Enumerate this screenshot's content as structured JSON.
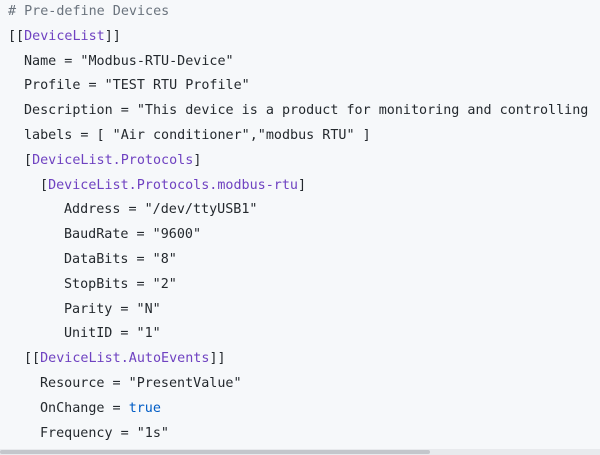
{
  "lines": {
    "l1": "# Pre-define Devices",
    "l2_open": "[[",
    "l2_sec": "DeviceList",
    "l2_close": "]]",
    "l3": "Name = \"Modbus-RTU-Device\"",
    "l4": "Profile = \"TEST RTU Profile\"",
    "l5": "Description = \"This device is a product for monitoring and controlling",
    "l6": "labels = [ \"Air conditioner\",\"modbus RTU\" ]",
    "l7_open": "[",
    "l7_sec": "DeviceList.Protocols",
    "l7_close": "]",
    "l8_open": "[",
    "l8_sec": "DeviceList.Protocols.modbus-rtu",
    "l8_close": "]",
    "l9": "Address = \"/dev/ttyUSB1\"",
    "l10": "BaudRate = \"9600\"",
    "l11": "DataBits = \"8\"",
    "l12": "StopBits = \"2\"",
    "l13": "Parity = \"N\"",
    "l14": "UnitID = \"1\"",
    "l15_open": "[[",
    "l15_sec": "DeviceList.AutoEvents",
    "l15_close": "]]",
    "l16": "Resource = \"PresentValue\"",
    "l17_key": "OnChange = ",
    "l17_val": "true",
    "l18": "Frequency = \"1s\""
  },
  "colors": {
    "background": "#f6f8fa",
    "text": "#24292e",
    "comment": "#6a737d",
    "section": "#6f42c1",
    "keyword": "#005cc5"
  }
}
